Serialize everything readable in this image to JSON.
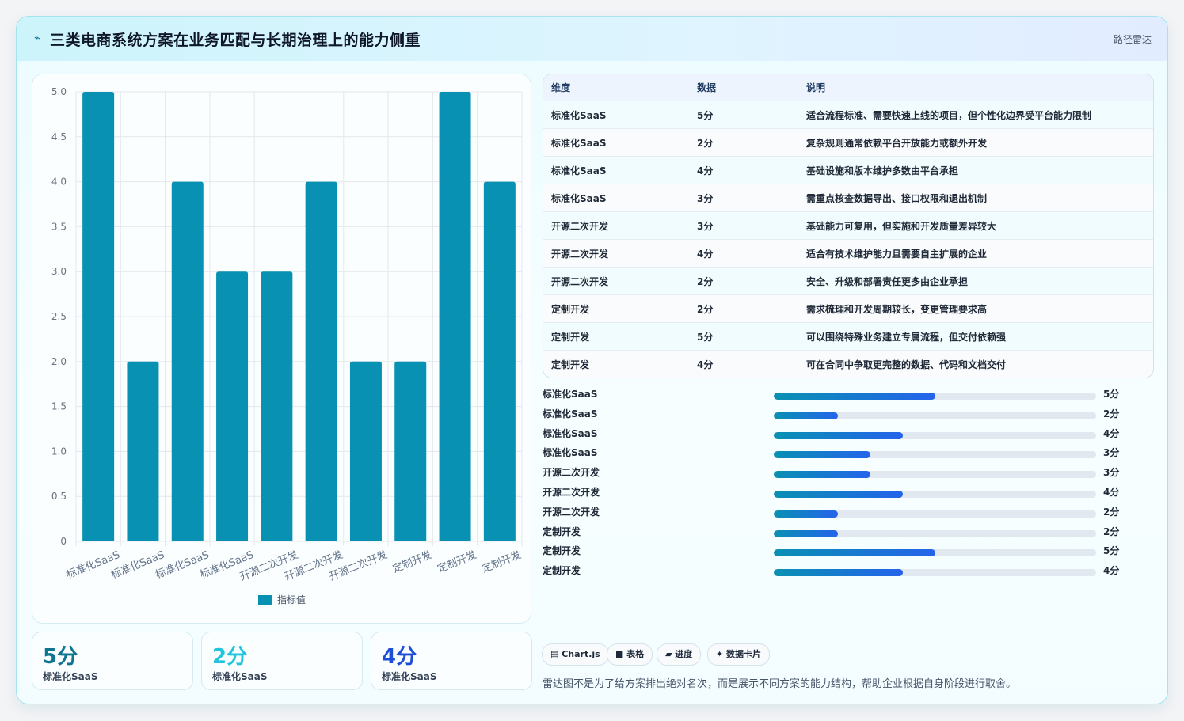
{
  "header": {
    "icon": "⌁",
    "title": "三类电商系统方案在业务匹配与长期治理上的能力侧重",
    "tag": "路径雷达"
  },
  "chart_data": {
    "type": "bar",
    "categories": [
      "标准化SaaS",
      "标准化SaaS",
      "标准化SaaS",
      "标准化SaaS",
      "开源二次开发",
      "开源二次开发",
      "开源二次开发",
      "定制开发",
      "定制开发",
      "定制开发"
    ],
    "series": [
      {
        "name": "指标值",
        "values": [
          5,
          2,
          4,
          3,
          3,
          4,
          2,
          2,
          5,
          4
        ]
      }
    ],
    "yticks": [
      "0",
      "0.5",
      "1.0",
      "1.5",
      "2.0",
      "2.5",
      "3.0",
      "3.5",
      "4.0",
      "4.5",
      "5.0"
    ],
    "ylim": [
      0,
      5
    ],
    "grid": true,
    "legend": "bottom",
    "color": "#0891b2"
  },
  "stats": [
    {
      "value": "5分",
      "label": "标准化SaaS",
      "color": "#0e7490"
    },
    {
      "value": "2分",
      "label": "标准化SaaS",
      "color": "#22c5dd"
    },
    {
      "value": "4分",
      "label": "标准化SaaS",
      "color": "#1d4ed8"
    }
  ],
  "table": {
    "headers": [
      "维度",
      "数据",
      "说明"
    ],
    "rows": [
      [
        "标准化SaaS",
        "5分",
        "适合流程标准、需要快速上线的项目，但个性化边界受平台能力限制"
      ],
      [
        "标准化SaaS",
        "2分",
        "复杂规则通常依赖平台开放能力或额外开发"
      ],
      [
        "标准化SaaS",
        "4分",
        "基础设施和版本维护多数由平台承担"
      ],
      [
        "标准化SaaS",
        "3分",
        "需重点核查数据导出、接口权限和退出机制"
      ],
      [
        "开源二次开发",
        "3分",
        "基础能力可复用，但实施和开发质量差异较大"
      ],
      [
        "开源二次开发",
        "4分",
        "适合有技术维护能力且需要自主扩展的企业"
      ],
      [
        "开源二次开发",
        "2分",
        "安全、升级和部署责任更多由企业承担"
      ],
      [
        "定制开发",
        "2分",
        "需求梳理和开发周期较长，变更管理要求高"
      ],
      [
        "定制开发",
        "5分",
        "可以围绕特殊业务建立专属流程，但交付依赖强"
      ],
      [
        "定制开发",
        "4分",
        "可在合同中争取更完整的数据、代码和文档交付"
      ]
    ]
  },
  "progress": [
    {
      "label": "标准化SaaS",
      "value": "5分",
      "fraction": 0.5
    },
    {
      "label": "标准化SaaS",
      "value": "2分",
      "fraction": 0.2
    },
    {
      "label": "标准化SaaS",
      "value": "4分",
      "fraction": 0.4
    },
    {
      "label": "标准化SaaS",
      "value": "3分",
      "fraction": 0.3
    },
    {
      "label": "开源二次开发",
      "value": "3分",
      "fraction": 0.3
    },
    {
      "label": "开源二次开发",
      "value": "4分",
      "fraction": 0.4
    },
    {
      "label": "开源二次开发",
      "value": "2分",
      "fraction": 0.2
    },
    {
      "label": "定制开发",
      "value": "2分",
      "fraction": 0.2
    },
    {
      "label": "定制开发",
      "value": "5分",
      "fraction": 0.5
    },
    {
      "label": "定制开发",
      "value": "4分",
      "fraction": 0.4
    }
  ],
  "chips": [
    "▤ Chart.js",
    "■ 表格",
    "▰ 进度",
    "✦ 数据卡片"
  ],
  "footnote": "雷达图不是为了给方案排出绝对名次，而是展示不同方案的能力结构，帮助企业根据自身阶段进行取舍。"
}
